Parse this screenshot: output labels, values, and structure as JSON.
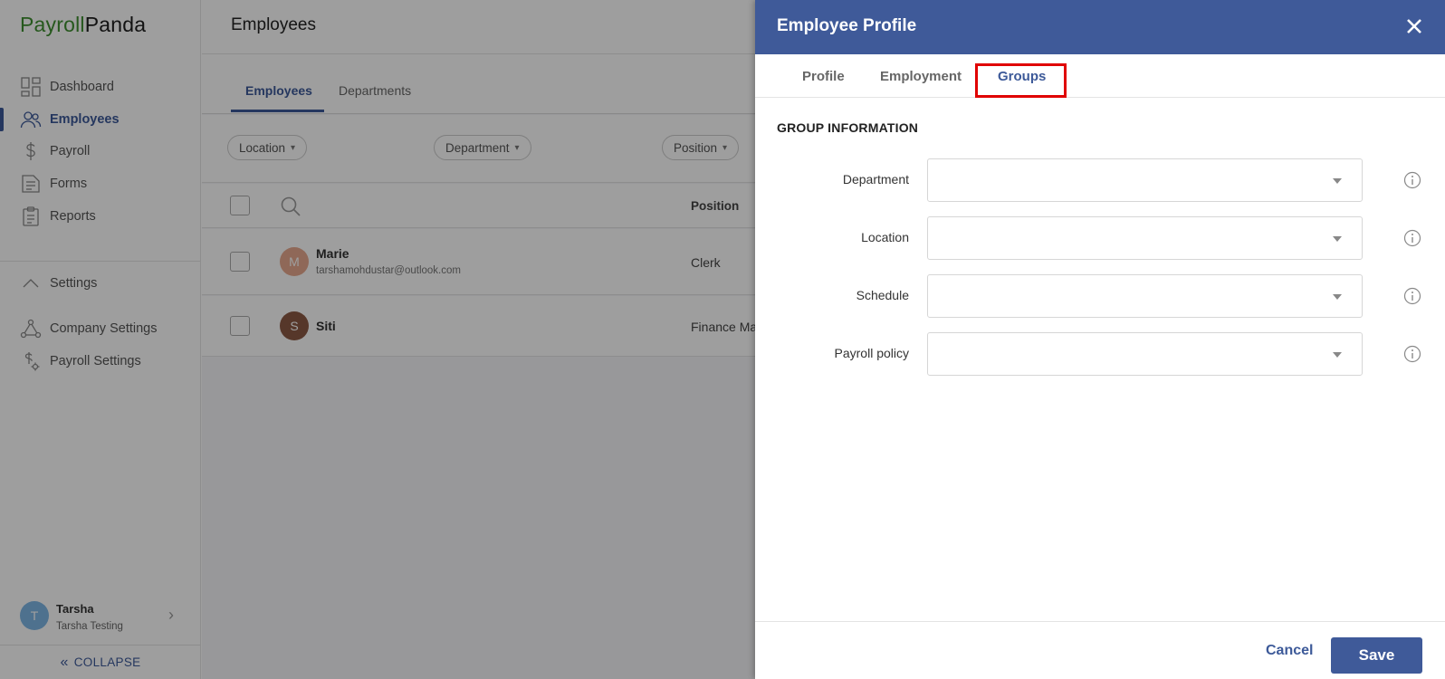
{
  "brand": {
    "part1": "Payroll",
    "part2": "Panda"
  },
  "sidebar": {
    "items": [
      {
        "label": "Dashboard",
        "icon": "dashboard-icon"
      },
      {
        "label": "Employees",
        "icon": "employees-icon",
        "active": true
      },
      {
        "label": "Payroll",
        "icon": "dollar-icon"
      },
      {
        "label": "Forms",
        "icon": "forms-icon"
      },
      {
        "label": "Reports",
        "icon": "clipboard-icon"
      }
    ],
    "settings_label": "Settings",
    "settings_items": [
      {
        "label": "Company Settings",
        "icon": "company-network-icon"
      },
      {
        "label": "Payroll Settings",
        "icon": "payroll-settings-icon"
      }
    ],
    "user": {
      "initial": "T",
      "name": "Tarsha",
      "org": "Tarsha Testing"
    },
    "collapse_label": "COLLAPSE"
  },
  "main": {
    "title": "Employees",
    "tabs": [
      {
        "label": "Employees",
        "active": true
      },
      {
        "label": "Departments"
      }
    ],
    "filters": [
      "Location",
      "Department",
      "Position"
    ],
    "table": {
      "columns": [
        "Position"
      ],
      "rows": [
        {
          "initial": "M",
          "name": "Marie",
          "email": "tarshamohdustar@outlook.com",
          "position": "Clerk",
          "avatar_color": "#e7a98e"
        },
        {
          "initial": "S",
          "name": "Siti",
          "email": "",
          "position": "Finance Ma",
          "avatar_color": "#8c5a45"
        }
      ]
    }
  },
  "drawer": {
    "title": "Employee Profile",
    "tabs": [
      {
        "label": "Profile"
      },
      {
        "label": "Employment"
      },
      {
        "label": "Groups",
        "active": true
      }
    ],
    "section_title": "GROUP INFORMATION",
    "fields": [
      {
        "label": "Department",
        "value": ""
      },
      {
        "label": "Location",
        "value": ""
      },
      {
        "label": "Schedule",
        "value": ""
      },
      {
        "label": "Payroll policy",
        "value": ""
      }
    ],
    "cancel_label": "Cancel",
    "save_label": "Save"
  },
  "colors": {
    "brand_green": "#3e8e2f",
    "accent_blue": "#3f5a99",
    "highlight_red": "#e00000"
  }
}
